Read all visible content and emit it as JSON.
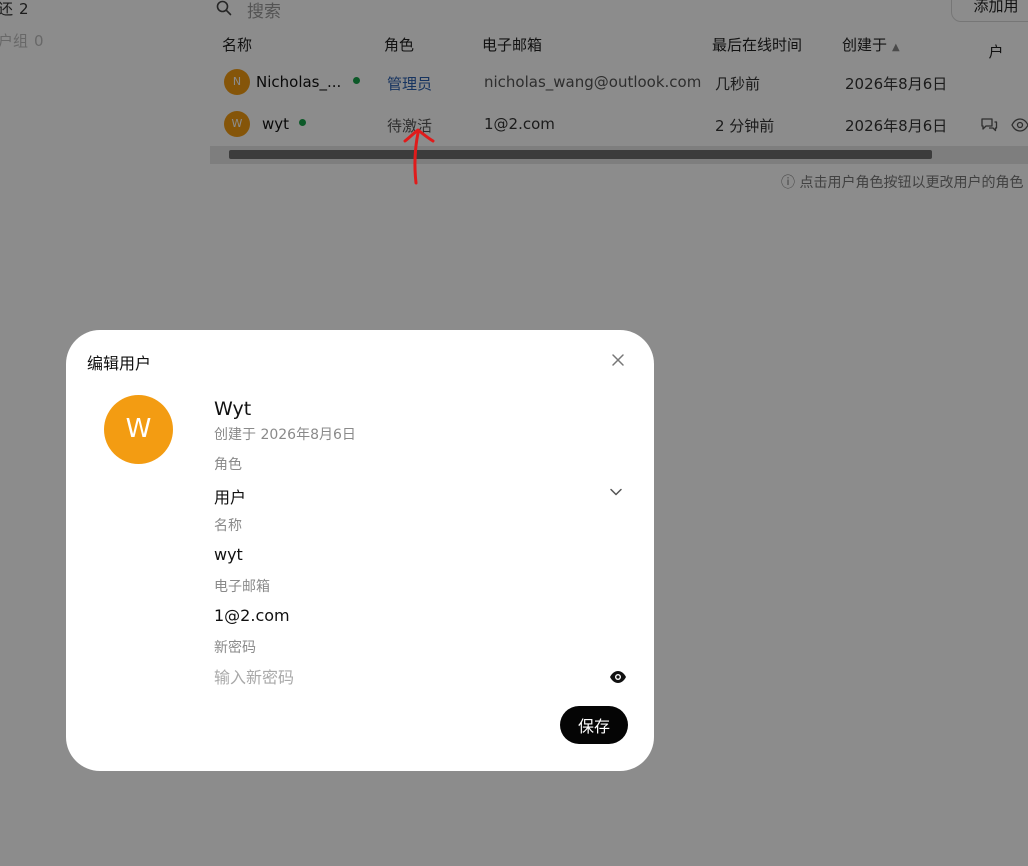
{
  "background_page": {
    "sidebar": [
      {
        "label": "还",
        "count": "2"
      },
      {
        "label": "户组",
        "count": "0"
      }
    ],
    "search": {
      "placeholder": "搜索"
    },
    "add_user_label": "添加用户",
    "table": {
      "headers": [
        "名称",
        "角色",
        "电子邮箱",
        "最后在线时间",
        "创建于"
      ],
      "sorted_column": "创建于",
      "rows": [
        {
          "avatar": "N",
          "name": "Nicholas_...",
          "role": "管理员",
          "email": "nicholas_wang@outlook.com",
          "last_active": "几秒前",
          "created": "2026年8月6日"
        },
        {
          "avatar": "W",
          "name": "wyt",
          "role": "待激活",
          "email": "1@2.com",
          "last_active": "2 分钟前",
          "created": "2026年8月6日"
        }
      ]
    },
    "hint": "点击用户角色按钮以更改用户的角色"
  },
  "modal": {
    "title": "编辑用户",
    "avatar_letter": "W",
    "user_name": "Wyt",
    "created_label": "创建于 2026年8月6日",
    "role_label": "角色",
    "role_value": "用户",
    "name_label": "名称",
    "name_value": "wyt",
    "email_label": "电子邮箱",
    "email_value": "1@2.com",
    "password_label": "新密码",
    "password_placeholder": "输入新密码",
    "save_label": "保存"
  },
  "colors": {
    "avatar": "#f39c12",
    "online": "#16a34a",
    "annotation": "#e01b1b",
    "overlay": "rgba(0,0,0,0.45)"
  }
}
